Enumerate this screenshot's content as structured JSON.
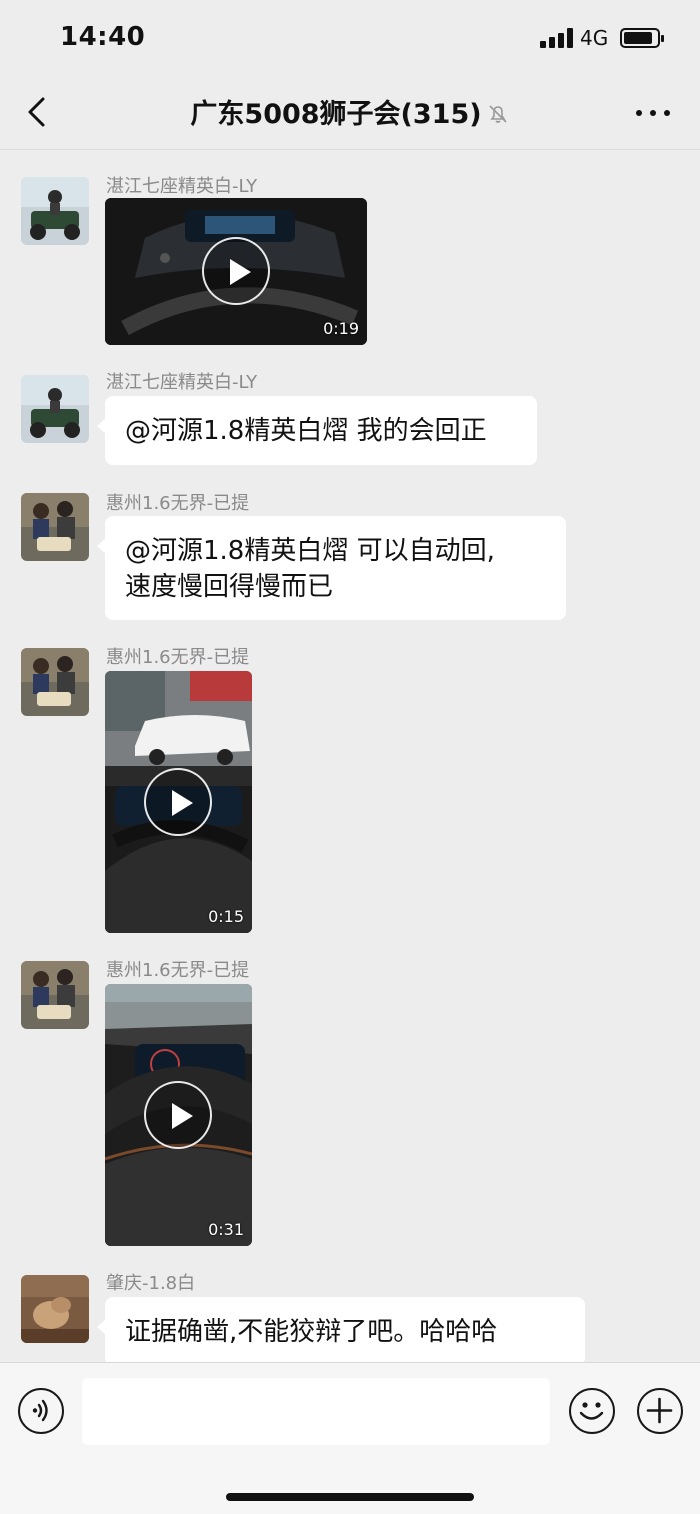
{
  "status_bar": {
    "time": "14:40",
    "network": "4G"
  },
  "header": {
    "title": "广东5008狮子会(315)"
  },
  "messages": [
    {
      "sender": "湛江七座精英白-LY",
      "type": "video",
      "duration": "0:19"
    },
    {
      "sender": "湛江七座精英白-LY",
      "type": "text",
      "lines": [
        "@河源1.8精英白熠 我的会回正"
      ]
    },
    {
      "sender": "惠州1.6无界-已提",
      "type": "text",
      "lines": [
        "@河源1.8精英白熠 可以自动回,",
        "速度慢回得慢而已"
      ]
    },
    {
      "sender": "惠州1.6无界-已提",
      "type": "video",
      "duration": "0:15"
    },
    {
      "sender": "惠州1.6无界-已提",
      "type": "video",
      "duration": "0:31"
    },
    {
      "sender": "肇庆-1.8白",
      "type": "text",
      "lines": [
        "证据确凿,不能狡辩了吧。哈哈哈"
      ]
    }
  ],
  "colors": {
    "background": "#ededed",
    "bubble": "#ffffff",
    "sender_text": "#8a8a8a"
  },
  "icons": [
    "back-icon",
    "mute-bell-icon",
    "more-icon",
    "voice-icon",
    "emoji-icon",
    "plus-icon",
    "play-icon"
  ]
}
